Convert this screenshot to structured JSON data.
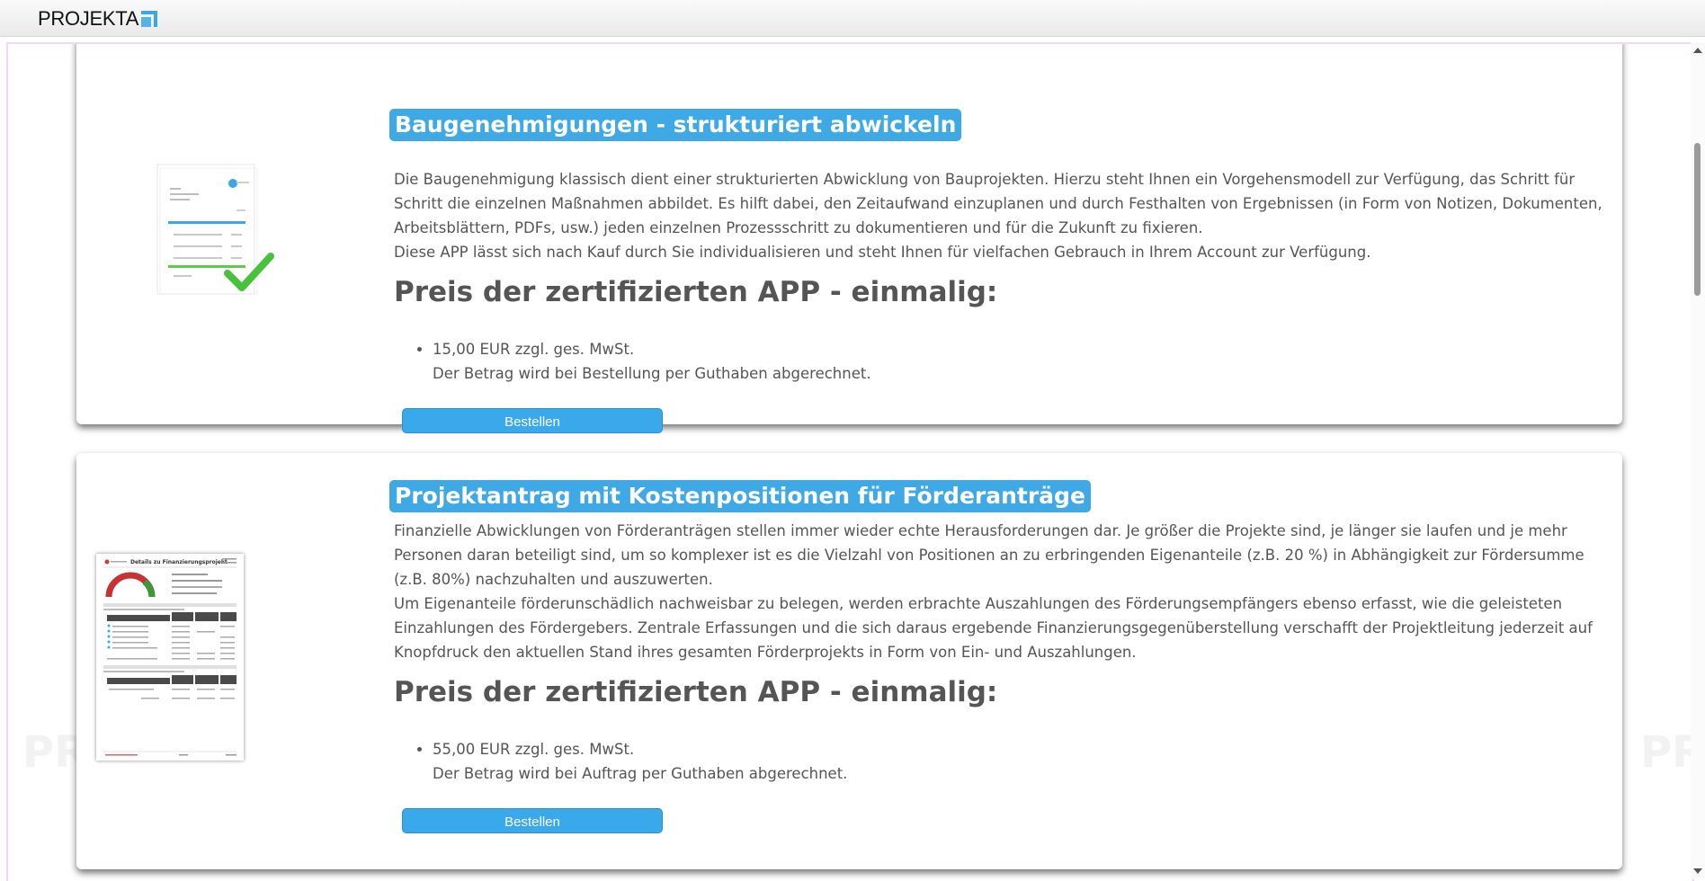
{
  "app": {
    "logo_text": "PROJEKTA",
    "accent_color": "#3aa7e6"
  },
  "watermark": {
    "left": "PR",
    "right": "PR"
  },
  "products": [
    {
      "title": "Baugenehmigungen - strukturiert abwickeln",
      "description": [
        "Die Baugenehmigung klassisch dient einer strukturierten Abwicklung von Bauprojekten. Hierzu steht Ihnen ein Vorgehensmodell zur Verfügung, das Schritt für Schritt die einzelnen Maßnahmen abbildet. Es hilft dabei, den Zeitaufwand einzuplanen und durch Festhalten von Ergebnissen (in Form von Notizen, Dokumenten, Arbeitsblättern, PDFs, usw.) jeden einzelnen Prozessschritt zu dokumentieren und für die Zukunft zu fixieren.",
        "Diese APP lässt sich nach Kauf durch Sie individualisieren und steht Ihnen für vielfachen Gebrauch in Ihrem Account zur Verfügung."
      ],
      "price_heading": "Preis der zertifizierten APP - einmalig:",
      "price": "15,00 EUR zzgl. ges. MwSt.",
      "price_note": "Der Betrag wird bei Bestellung per Guthaben abgerechnet.",
      "button_label": "Bestellen",
      "thumbnail_icon": "document-checkmark-icon"
    },
    {
      "title": "Projektantrag mit Kostenpositionen für Förderanträge",
      "description": [
        "Finanzielle Abwicklungen von Förderanträgen stellen immer wieder echte Herausforderungen dar. Je größer die Projekte sind, je länger sie laufen und je mehr Personen daran beteiligt sind, um so komplexer ist es die Vielzahl von Positionen an zu erbringenden Eigenanteile (z.B. 20 %) in Abhängigkeit zur Fördersumme (z.B.  80%) nachzuhalten und auszuwerten.",
        "Um Eigenanteile förderunschädlich nachweisbar zu belegen, werden erbrachte Auszahlungen des Förderungsempfängers ebenso erfasst, wie die geleisteten Einzahlungen des Fördergebers. Zentrale Erfassungen und die sich daraus ergebende Finanzierungsgegenüberstellung verschafft der Projektleitung jederzeit auf Knopfdruck den aktuellen Stand ihres gesamten Förderprojekts in Form von Ein- und Auszahlungen."
      ],
      "price_heading": "Preis der zertifizierten APP - einmalig:",
      "price": "55,00 EUR zzgl. ges. MwSt.",
      "price_note": "Der Betrag wird bei Auftrag per Guthaben abgerechnet.",
      "button_label": "Bestellen",
      "thumbnail_title": "Details zu Finanzierungsprojekt",
      "thumbnail_icon": "finance-report-thumbnail"
    }
  ]
}
